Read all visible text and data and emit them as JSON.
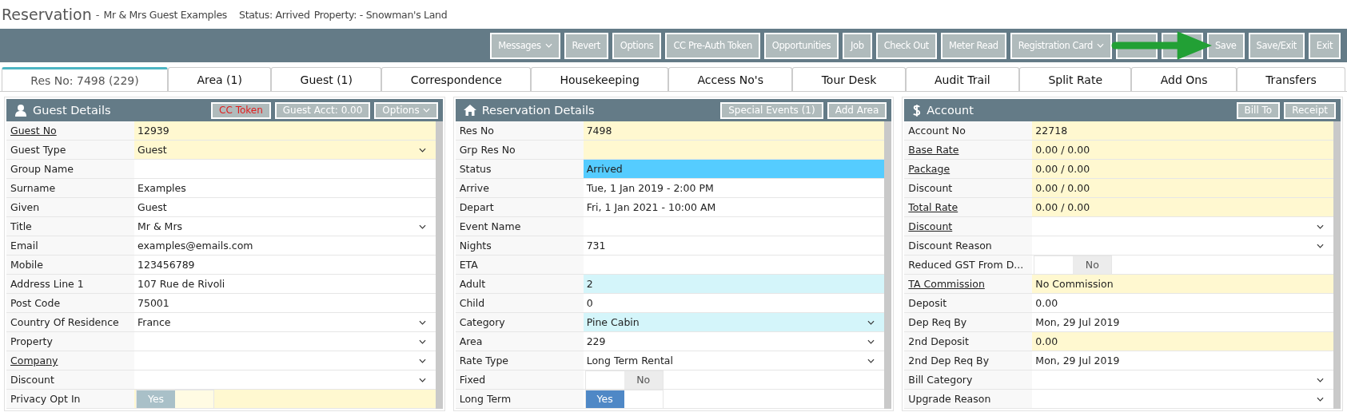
{
  "header": {
    "title": "Reservation",
    "separator": "-",
    "guest": "Mr & Mrs Guest Examples",
    "status": "Status: Arrived",
    "property": "Property: - Snowman's Land"
  },
  "toolbar": {
    "callout_arrow": true,
    "buttons": [
      {
        "label": "Messages",
        "caret": true
      },
      {
        "label": "Revert",
        "caret": false
      },
      {
        "label": "Options",
        "caret": false
      },
      {
        "label": "CC Pre-Auth Token",
        "caret": false
      },
      {
        "label": "Opportunities",
        "caret": false
      },
      {
        "label": "Job",
        "caret": false
      },
      {
        "label": "Check Out",
        "caret": false
      },
      {
        "label": "Meter Read",
        "caret": false
      },
      {
        "label": "Registration Card",
        "caret": true
      },
      {
        "kind": "covered"
      },
      {
        "kind": "covered"
      },
      {
        "label": "Save",
        "caret": false
      },
      {
        "label": "Save/Exit",
        "caret": false
      },
      {
        "label": "Exit",
        "caret": false
      }
    ]
  },
  "tabs": [
    {
      "label": "Res No: 7498 (229)",
      "selected": true
    },
    {
      "label": "Area (1)",
      "selected": false
    },
    {
      "label": "Guest (1)",
      "selected": false
    },
    {
      "label": "Correspondence",
      "selected": false
    },
    {
      "label": "Housekeeping",
      "selected": false
    },
    {
      "label": "Access No's",
      "selected": false
    },
    {
      "label": "Tour Desk",
      "selected": false
    },
    {
      "label": "Audit Trail",
      "selected": false
    },
    {
      "label": "Split Rate",
      "selected": false
    },
    {
      "label": "Add Ons",
      "selected": false
    },
    {
      "label": "Transfers",
      "selected": false
    }
  ],
  "panels": [
    {
      "title": "Guest Details",
      "buttons": [
        {
          "label": "CC Token",
          "alert": true,
          "caret": false
        },
        {
          "label": "Guest Acct: 0.00",
          "alert": false,
          "caret": false
        },
        {
          "label": "Options",
          "alert": false,
          "caret": true
        }
      ],
      "rows": [
        {
          "label": "Guest No",
          "link": true,
          "kind": "text",
          "value": "12939",
          "color": "#fff8d0"
        },
        {
          "label": "Guest Type",
          "link": false,
          "kind": "select",
          "value": "Guest",
          "color": "#fff8d0"
        },
        {
          "label": "Group Name",
          "link": false,
          "kind": "text",
          "color": "#ffffff"
        },
        {
          "label": "Surname",
          "link": false,
          "kind": "text",
          "value": "Examples",
          "color": "#ffffff"
        },
        {
          "label": "Given",
          "link": false,
          "kind": "text",
          "value": "Guest",
          "color": "#ffffff"
        },
        {
          "label": "Title",
          "link": false,
          "kind": "select",
          "value": "Mr & Mrs",
          "color": "#ffffff"
        },
        {
          "label": "Email",
          "link": false,
          "kind": "text",
          "value": "examples@emails.com",
          "color": "#ffffff"
        },
        {
          "label": "Mobile",
          "link": false,
          "kind": "text",
          "value": "123456789",
          "color": "#ffffff"
        },
        {
          "label": "Address Line 1",
          "link": false,
          "kind": "text",
          "value": "107 Rue de Rivoli",
          "color": "#ffffff"
        },
        {
          "label": "Post Code",
          "link": false,
          "kind": "text",
          "value": "75001",
          "color": "#ffffff"
        },
        {
          "label": "Country Of Residence",
          "link": false,
          "kind": "select",
          "value": "France",
          "color": "#ffffff"
        },
        {
          "label": "Property",
          "link": false,
          "kind": "select",
          "color": "#ffffff"
        },
        {
          "label": "Company",
          "link": true,
          "kind": "select",
          "color": "#ffffff"
        },
        {
          "label": "Discount",
          "link": false,
          "kind": "select",
          "color": "#ffffff"
        },
        {
          "label": "Privacy Opt In",
          "link": false,
          "kind": "toggle",
          "value": "Yes",
          "on": true,
          "disabled": true,
          "color": "#fff8d0"
        }
      ]
    },
    {
      "title": "Reservation Details",
      "buttons": [
        {
          "label": "Special Events (1)",
          "alert": false,
          "caret": false
        },
        {
          "label": "Add Area",
          "alert": false,
          "caret": false
        }
      ],
      "rows": [
        {
          "label": "Res No",
          "link": false,
          "kind": "text",
          "value": "7498",
          "color": "#fff8d0"
        },
        {
          "label": "Grp Res No",
          "link": false,
          "kind": "text",
          "color": "#fff8d0"
        },
        {
          "label": "Status",
          "link": false,
          "kind": "text",
          "value": "Arrived",
          "color": "#55ccff"
        },
        {
          "label": "Arrive",
          "link": false,
          "kind": "text",
          "value": "Tue, 1 Jan 2019 - 2:00 PM",
          "color": "#ffffff"
        },
        {
          "label": "Depart",
          "link": false,
          "kind": "text",
          "value": "Fri, 1 Jan 2021 - 10:00 AM",
          "color": "#ffffff"
        },
        {
          "label": "Event Name",
          "link": false,
          "kind": "text",
          "color": "#ffffff"
        },
        {
          "label": "Nights",
          "link": false,
          "kind": "text",
          "value": "731",
          "color": "#ffffff"
        },
        {
          "label": "ETA",
          "link": false,
          "kind": "text",
          "color": "#ffffff"
        },
        {
          "label": "Adult",
          "link": false,
          "kind": "text",
          "value": "2",
          "color": "#d4f5fa"
        },
        {
          "label": "Child",
          "link": false,
          "kind": "text",
          "value": "0",
          "color": "#ffffff"
        },
        {
          "label": "Category",
          "link": false,
          "kind": "select",
          "value": "Pine Cabin",
          "color": "#d4f5fa"
        },
        {
          "label": "Area",
          "link": false,
          "kind": "select",
          "value": "229",
          "color": "#ffffff"
        },
        {
          "label": "Rate Type",
          "link": false,
          "kind": "select",
          "value": "Long Term Rental",
          "color": "#ffffff"
        },
        {
          "label": "Fixed",
          "link": false,
          "kind": "toggle",
          "value": "No",
          "on": false,
          "disabled": false,
          "color": "#ffffff"
        },
        {
          "label": "Long Term",
          "link": false,
          "kind": "toggle",
          "value": "Yes",
          "on": true,
          "disabled": false,
          "color": "#ffffff"
        }
      ]
    },
    {
      "title": "Account",
      "buttons": [
        {
          "label": "Bill To",
          "alert": false,
          "caret": false
        },
        {
          "label": "Receipt",
          "alert": false,
          "caret": false
        }
      ],
      "rows": [
        {
          "label": "Account No",
          "link": false,
          "kind": "text",
          "value": "22718",
          "color": "#fff8d0"
        },
        {
          "label": "Base Rate",
          "link": true,
          "kind": "text",
          "value": "0.00 / 0.00",
          "color": "#fff8d0"
        },
        {
          "label": "Package",
          "link": true,
          "kind": "text",
          "value": "0.00 / 0.00",
          "color": "#fff8d0"
        },
        {
          "label": "Discount",
          "link": false,
          "kind": "text",
          "value": "0.00 / 0.00",
          "color": "#fff8d0"
        },
        {
          "label": "Total Rate",
          "link": true,
          "kind": "text",
          "value": "0.00 / 0.00",
          "color": "#fff8d0"
        },
        {
          "label": "Discount",
          "link": true,
          "kind": "select",
          "color": "#ffffff"
        },
        {
          "label": "Discount Reason",
          "link": false,
          "kind": "select",
          "color": "#ffffff"
        },
        {
          "label": "Reduced GST From D...",
          "link": false,
          "kind": "toggle",
          "value": "No",
          "on": false,
          "disabled": false,
          "color": "#ffffff"
        },
        {
          "label": "TA Commission",
          "link": true,
          "kind": "text",
          "value": "No Commission",
          "color": "#fff8d0"
        },
        {
          "label": "Deposit",
          "link": false,
          "kind": "text",
          "value": "0.00",
          "color": "#ffffff"
        },
        {
          "label": "Dep Req By",
          "link": false,
          "kind": "text",
          "value": "Mon, 29 Jul 2019",
          "color": "#ffffff"
        },
        {
          "label": "2nd Deposit",
          "link": false,
          "kind": "text",
          "value": "0.00",
          "color": "#fff8d0"
        },
        {
          "label": "2nd Dep Req By",
          "link": false,
          "kind": "text",
          "value": "Mon, 29 Jul 2019",
          "color": "#ffffff"
        },
        {
          "label": "Bill Category",
          "link": false,
          "kind": "select",
          "color": "#ffffff"
        },
        {
          "label": "Upgrade Reason",
          "link": false,
          "kind": "select",
          "color": "#ffffff"
        }
      ]
    }
  ]
}
